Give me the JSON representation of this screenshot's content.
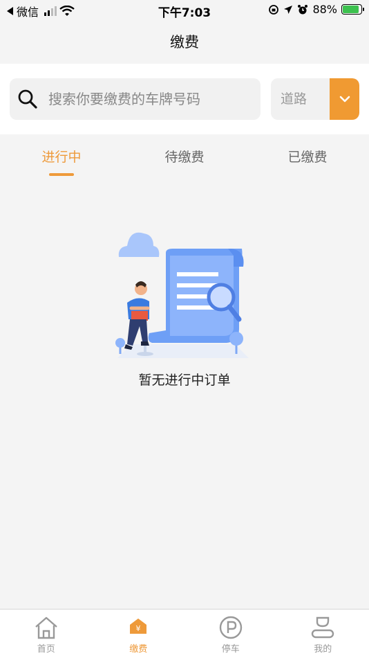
{
  "status_bar": {
    "back_app": "微信",
    "time": "下午7:03",
    "battery_pct": "88%"
  },
  "nav": {
    "title": "缴费"
  },
  "search": {
    "placeholder": "搜索你要缴费的车牌号码",
    "value": ""
  },
  "road_select": {
    "selected": "道路"
  },
  "tabs": [
    {
      "label": "进行中",
      "active": true
    },
    {
      "label": "待缴费",
      "active": false
    },
    {
      "label": "已缴费",
      "active": false
    }
  ],
  "empty_state": {
    "message": "暂无进行中订单"
  },
  "bottom_tabs": [
    {
      "label": "首页",
      "icon": "home-icon",
      "active": false
    },
    {
      "label": "缴费",
      "icon": "payment-icon",
      "active": true
    },
    {
      "label": "停车",
      "icon": "parking-icon",
      "active": false
    },
    {
      "label": "我的",
      "icon": "profile-icon",
      "active": false
    }
  ],
  "colors": {
    "accent": "#ee9a3a",
    "background": "#f4f4f4",
    "battery_green": "#3cc14e"
  }
}
